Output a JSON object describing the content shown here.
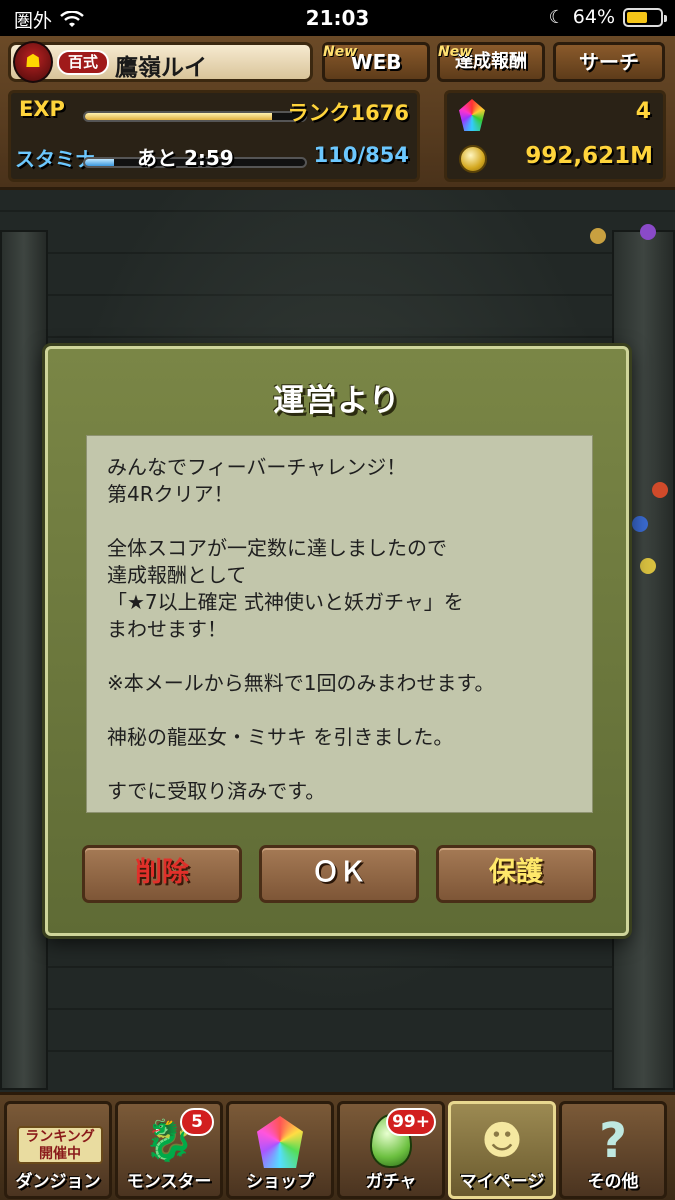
{
  "status_bar": {
    "carrier": "圏外",
    "time": "21:03",
    "battery_percent": "64%",
    "battery_level": 0.64
  },
  "player": {
    "rank_badge": "百式",
    "name": "鷹嶺ルイ"
  },
  "header_buttons": {
    "web_label": "WEB",
    "web_new": "New",
    "achievement_label": "達成報酬",
    "achievement_new": "New",
    "search_label": "サーチ"
  },
  "stats": {
    "exp_label": "EXP",
    "exp_progress": 0.85,
    "rank_text": "ランク1676",
    "stamina_label": "スタミナ",
    "stamina_progress": 0.13,
    "stamina_timer": "あと 2:59",
    "stamina_value": "110/854"
  },
  "currency": {
    "magic_stones": "4",
    "coins": "992,621M"
  },
  "dialog": {
    "title": "運営より",
    "message_lines": [
      "みんなでフィーバーチャレンジ！",
      "第4Rクリア！",
      "",
      "全体スコアが一定数に達しましたので",
      "達成報酬として",
      "「★7以上確定 式神使いと妖ガチャ」を",
      "まわせます！",
      "",
      "※本メールから無料で1回のみまわせます。",
      "",
      "神秘の龍巫女・ミサキ を引きました。",
      "",
      "すでに受取り済みです。"
    ],
    "delete_label": "削除",
    "ok_label": "ＯＫ",
    "protect_label": "保護"
  },
  "bottom_nav": {
    "dungeon_label": "ダンジョン",
    "ranking_tag_line1": "ランキング",
    "ranking_tag_line2": "開催中",
    "monster_label": "モンスター",
    "monster_badge": "5",
    "shop_label": "ショップ",
    "gacha_label": "ガチャ",
    "gacha_badge": "99+",
    "mypage_label": "マイページ",
    "other_label": "その他"
  },
  "colors": {
    "accent_gold": "#ffd43b",
    "stamina_blue": "#6cc8ff",
    "dialog_green": "#6f7b3f",
    "delete_red": "#e0302a",
    "protect_yellow": "#ffe86a"
  }
}
